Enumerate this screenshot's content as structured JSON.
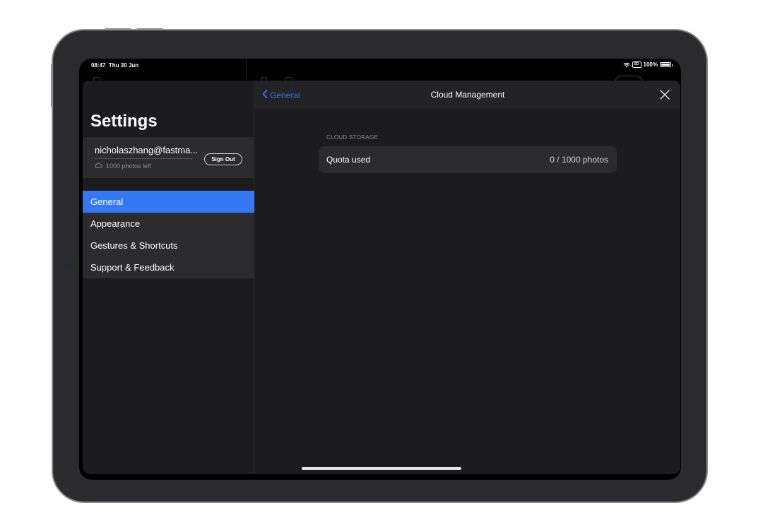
{
  "status_bar": {
    "time": "08:47",
    "date": "Thu 30 Jun",
    "sd_label": "SD",
    "battery": "100%"
  },
  "sidebar": {
    "title": "Settings",
    "account": {
      "email": "nicholaszhang@fastma...",
      "quota": "1000 photos left",
      "sign_out_label": "Sign Out"
    },
    "items": [
      {
        "label": "General",
        "active": true
      },
      {
        "label": "Appearance",
        "active": false
      },
      {
        "label": "Gestures & Shortcuts",
        "active": false
      },
      {
        "label": "Support & Feedback",
        "active": false
      }
    ]
  },
  "detail": {
    "back_label": "General",
    "title": "Cloud Management",
    "section_header": "CLOUD STORAGE",
    "rows": [
      {
        "label": "Quota used",
        "value": "0 / 1000 photos"
      }
    ]
  },
  "colors": {
    "accent": "#3478f6",
    "sheet_background": "#1c1c1e",
    "cell_background": "#2c2c2e"
  },
  "icons": {
    "back": "chevron-left-icon",
    "close": "close-icon",
    "cloud": "cloud-icon",
    "wifi": "wifi-icon",
    "battery": "battery-icon"
  }
}
